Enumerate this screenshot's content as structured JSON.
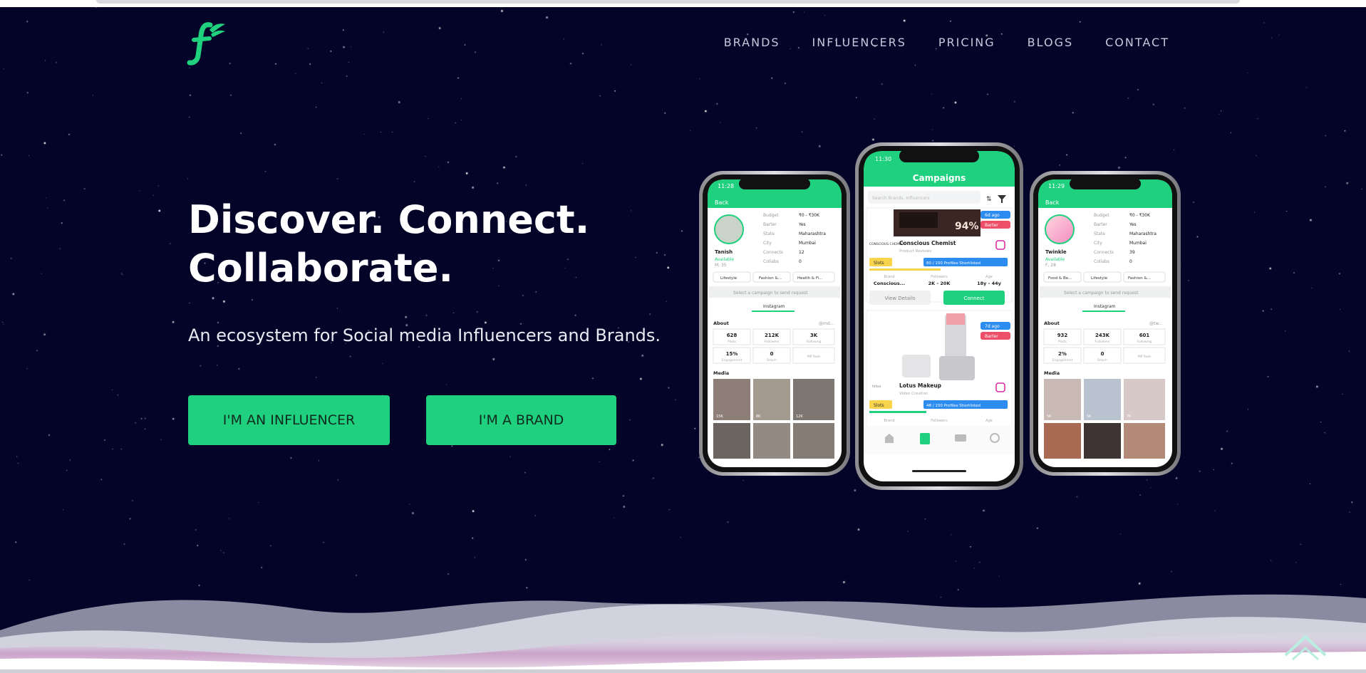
{
  "brand": {
    "logo_letter": "f",
    "accent_color": "#1fd17e",
    "background_color": "#030427"
  },
  "nav": {
    "items": [
      {
        "label": "BRANDS"
      },
      {
        "label": "INFLUENCERS"
      },
      {
        "label": "PRICING"
      },
      {
        "label": "BLOGS"
      },
      {
        "label": "CONTACT"
      }
    ]
  },
  "hero": {
    "headline_line1": "Discover. Connect.",
    "headline_line2": "Collaborate.",
    "tagline": "An ecosystem for Social media Influencers and Brands.",
    "influencer_button": "I'M AN INFLUENCER",
    "brand_button": "I'M A BRAND"
  },
  "phones": {
    "left": {
      "time": "11:28",
      "back": "Back",
      "name": "Tanish",
      "availability": "Available",
      "meta": "M, 35",
      "details": [
        {
          "label": "Budget",
          "value": "₹0 - ₹30K"
        },
        {
          "label": "Barter",
          "value": "Yes"
        },
        {
          "label": "State",
          "value": "Maharashtra"
        },
        {
          "label": "City",
          "value": "Mumbai"
        },
        {
          "label": "Connects",
          "value": "12"
        },
        {
          "label": "Collabs",
          "value": "0"
        }
      ],
      "tags": [
        "Lifestyle",
        "Fashion &...",
        "Health & Fi..."
      ],
      "select_text": "Select a campaign to send request",
      "tab": "Instagram",
      "about": "About",
      "handle": "@md...",
      "stats": [
        {
          "value": "628",
          "label": "Posts"
        },
        {
          "value": "212K",
          "label": "Followers"
        },
        {
          "value": "3K",
          "label": "Following"
        },
        {
          "value": "15%",
          "label": "Engagement"
        },
        {
          "value": "0",
          "label": "Reach"
        },
        {
          "value": "",
          "label": "MP Rate"
        }
      ],
      "media": "Media",
      "media_likes": [
        "15K",
        "8K",
        "12K"
      ]
    },
    "center": {
      "time": "11:30",
      "title": "Campaigns",
      "search_placeholder": "Search Brands, Influencers",
      "card1": {
        "banner_text": "94%",
        "badge_time": "6d ago",
        "badge_barter": "Barter",
        "logo_text": "CONSCIOUS CHEMIST",
        "name": "Conscious Chemist",
        "category": "Product Reviews",
        "slots": "Slots",
        "shortlisted": "80 / 150 Profiles Shortlisted",
        "brand_label": "Brand",
        "brand_value": "Conscious...",
        "followers_label": "Followers",
        "followers_value": "2K - 20K",
        "age_label": "Age",
        "age_value": "18y - 44y",
        "view_details": "View Details",
        "connect": "Connect"
      },
      "card2": {
        "badge_time": "7d ago",
        "badge_barter": "Barter",
        "logo_text": "lotus",
        "name": "Lotus Makeup",
        "category": "Video Creation",
        "slots": "Slots",
        "shortlisted": "48 / 150 Profiles Shortlisted",
        "brand_label": "Brand",
        "followers_label": "Followers",
        "age_label": "Age"
      }
    },
    "right": {
      "time": "11:29",
      "back": "Back",
      "name": "Twinkle",
      "availability": "Available",
      "meta": "F, 28",
      "details": [
        {
          "label": "Budget",
          "value": "₹0 - ₹30K"
        },
        {
          "label": "Barter",
          "value": "Yes"
        },
        {
          "label": "State",
          "value": "Maharashtra"
        },
        {
          "label": "City",
          "value": "Mumbai"
        },
        {
          "label": "Connects",
          "value": "39"
        },
        {
          "label": "Collabs",
          "value": "0"
        }
      ],
      "tags": [
        "Food & Be...",
        "Lifestyle",
        "Fashion &..."
      ],
      "select_text": "Select a campaign to send request",
      "tab": "Instagram",
      "about": "About",
      "handle": "@tw...",
      "stats": [
        {
          "value": "932",
          "label": "Posts"
        },
        {
          "value": "243K",
          "label": "Followers"
        },
        {
          "value": "601",
          "label": "Following"
        },
        {
          "value": "2%",
          "label": "Engagement"
        },
        {
          "value": "0",
          "label": "Reach"
        },
        {
          "value": "",
          "label": "MP Rate"
        }
      ],
      "media": "Media",
      "media_likes": [
        "5K",
        "5K",
        "7K"
      ]
    }
  }
}
